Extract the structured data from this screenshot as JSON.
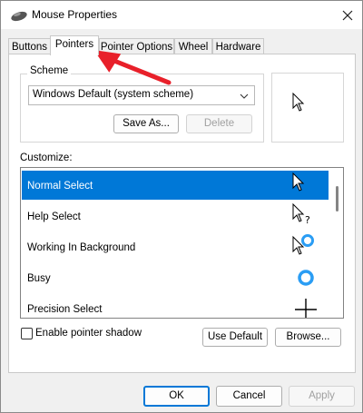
{
  "window": {
    "title": "Mouse Properties",
    "icon": "mouse-icon",
    "close_icon": "close-icon"
  },
  "tabs": [
    {
      "label": "Buttons",
      "active": false
    },
    {
      "label": "Pointers",
      "active": true
    },
    {
      "label": "Pointer Options",
      "active": false
    },
    {
      "label": "Wheel",
      "active": false
    },
    {
      "label": "Hardware",
      "active": false
    }
  ],
  "scheme": {
    "legend": "Scheme",
    "selected": "Windows Default (system scheme)",
    "save_as_label": "Save As...",
    "delete_label": "Delete",
    "delete_enabled": false
  },
  "customize": {
    "label": "Customize:",
    "items": [
      {
        "label": "Normal Select",
        "selected": true,
        "icon": "arrow-cursor-icon"
      },
      {
        "label": "Help Select",
        "selected": false,
        "icon": "help-cursor-icon"
      },
      {
        "label": "Working In Background",
        "selected": false,
        "icon": "working-cursor-icon"
      },
      {
        "label": "Busy",
        "selected": false,
        "icon": "busy-cursor-icon"
      },
      {
        "label": "Precision Select",
        "selected": false,
        "icon": "crosshair-cursor-icon"
      }
    ]
  },
  "shadow": {
    "label": "Enable pointer shadow",
    "checked": false
  },
  "buttons": {
    "use_default": "Use Default",
    "browse": "Browse...",
    "ok": "OK",
    "cancel": "Cancel",
    "apply": "Apply",
    "apply_enabled": false
  },
  "colors": {
    "selection": "#0078d7",
    "arrow_annotation": "#e8202a"
  }
}
